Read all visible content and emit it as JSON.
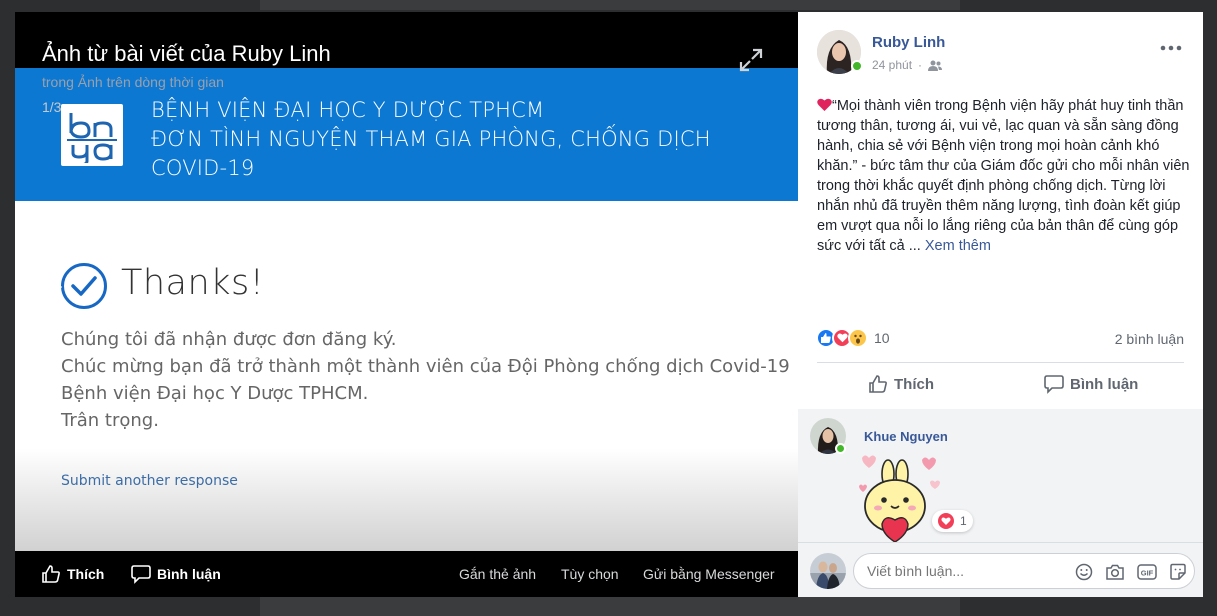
{
  "viewer": {
    "title": "Ảnh từ bài viết của Ruby Linh",
    "subtitle": "trong Ảnh trên dòng thời gian",
    "counter": "1/3",
    "bar": {
      "like": "Thích",
      "comment": "Bình luận",
      "tag": "Gắn thẻ ảnh",
      "options": "Tùy chọn",
      "send": "Gửi bằng Messenger"
    }
  },
  "photo": {
    "banner_line1": "BỆNH VIỆN ĐẠI HỌC Y DƯỢC TPHCM",
    "banner_line2": "ĐƠN TÌNH NGUYỆN THAM GIA PHÒNG, CHỐNG DỊCH COVID-19",
    "thanks": "Thanks!",
    "msg_line1": "Chúng tôi đã nhận được đơn đăng ký.",
    "msg_line2": "Chúc mừng bạn đã trở thành một thành viên của Đội Phòng chống dịch Covid-19",
    "msg_line3": "Bệnh viện Đại học Y Dược TPHCM.",
    "msg_line4": "Trân trọng.",
    "submit_link": "Submit another response"
  },
  "post": {
    "author": "Ruby Linh",
    "time": "24 phút",
    "text": "“Mọi thành viên trong Bệnh viện hãy phát huy tinh thần tương thân, tương ái, vui vẻ, lạc quan và sẵn sàng đồng hành, chia sẻ với Bệnh viện trong mọi hoàn cảnh khó khăn.” - bức tâm thư của Giám đốc gửi cho mỗi nhân viên trong thời khắc quyết định phòng chống dịch. Từng lời nhắn nhủ đã truyền thêm năng lượng, tình đoàn kết giúp em vượt qua nỗi lo lắng riêng của bản thân để cùng góp sức với tất cả ...",
    "see_more": "Xem thêm",
    "reaction_count": "10",
    "comment_count": "2 bình luận",
    "like_label": "Thích",
    "comment_label": "Bình luận"
  },
  "comment": {
    "author": "Khue Nguyen",
    "reaction_count": "1"
  },
  "composer": {
    "placeholder": "Viết bình luận..."
  },
  "colors": {
    "banner": "#0d78d2",
    "link": "#385898",
    "online": "#42b72a"
  }
}
